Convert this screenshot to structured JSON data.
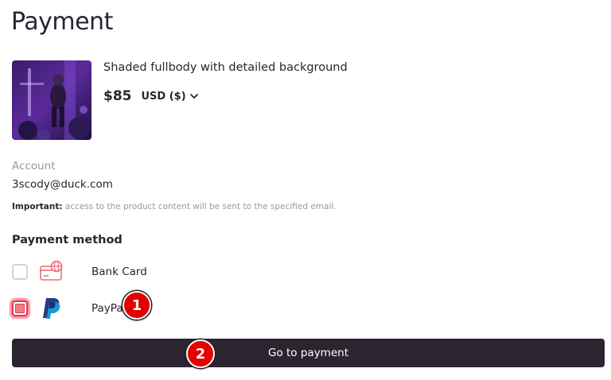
{
  "page": {
    "title": "Payment"
  },
  "product": {
    "title": "Shaded fullbody with detailed background",
    "price": "$85",
    "currency_label": "USD ($)"
  },
  "account": {
    "label": "Account",
    "email": "3scody@duck.com",
    "important_prefix": "Important:",
    "important_text": " access to the product content will be sent to the specified email."
  },
  "payment": {
    "heading": "Payment method",
    "methods": [
      {
        "label": "Bank Card",
        "icon": "bank-card-icon",
        "selected": false
      },
      {
        "label": "PayPal",
        "icon": "paypal-icon",
        "selected": true
      }
    ],
    "submit_label": "Go to payment"
  },
  "markers": [
    "1",
    "2"
  ],
  "colors": {
    "primary": "#2b2431",
    "accent_red": "#e0394a",
    "muted": "#9a97a0",
    "marker": "#e20000"
  }
}
